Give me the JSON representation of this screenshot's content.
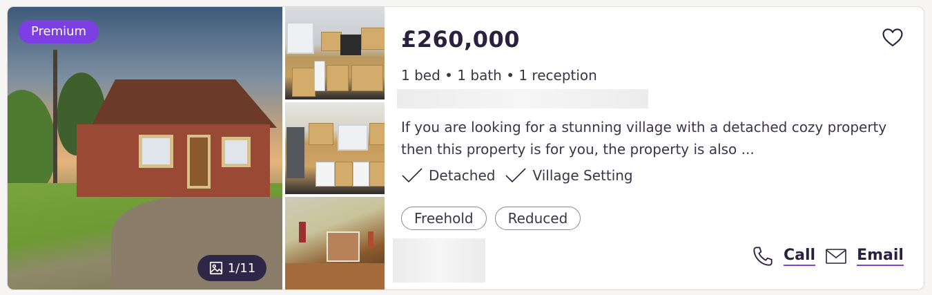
{
  "listing": {
    "badge": "Premium",
    "photo_count": "1/11",
    "price": "£260,000",
    "specs": "1 bed • 1 bath • 1 reception",
    "description": "If you are looking for a stunning village with a detached cozy property then this property is for you, the property is also ...",
    "features": [
      "Detached",
      "Village Setting"
    ],
    "tags": [
      "Freehold",
      "Reduced"
    ],
    "actions": {
      "call": "Call",
      "email": "Email"
    }
  },
  "icons": {
    "favourite": "heart-outline-icon",
    "gallery": "image-icon",
    "feature": "checkmark-icon",
    "call": "phone-icon",
    "email": "envelope-icon"
  },
  "colors": {
    "accent": "#7b3fe4",
    "badge_dark": "#2e2748",
    "text": "#2a2040"
  }
}
